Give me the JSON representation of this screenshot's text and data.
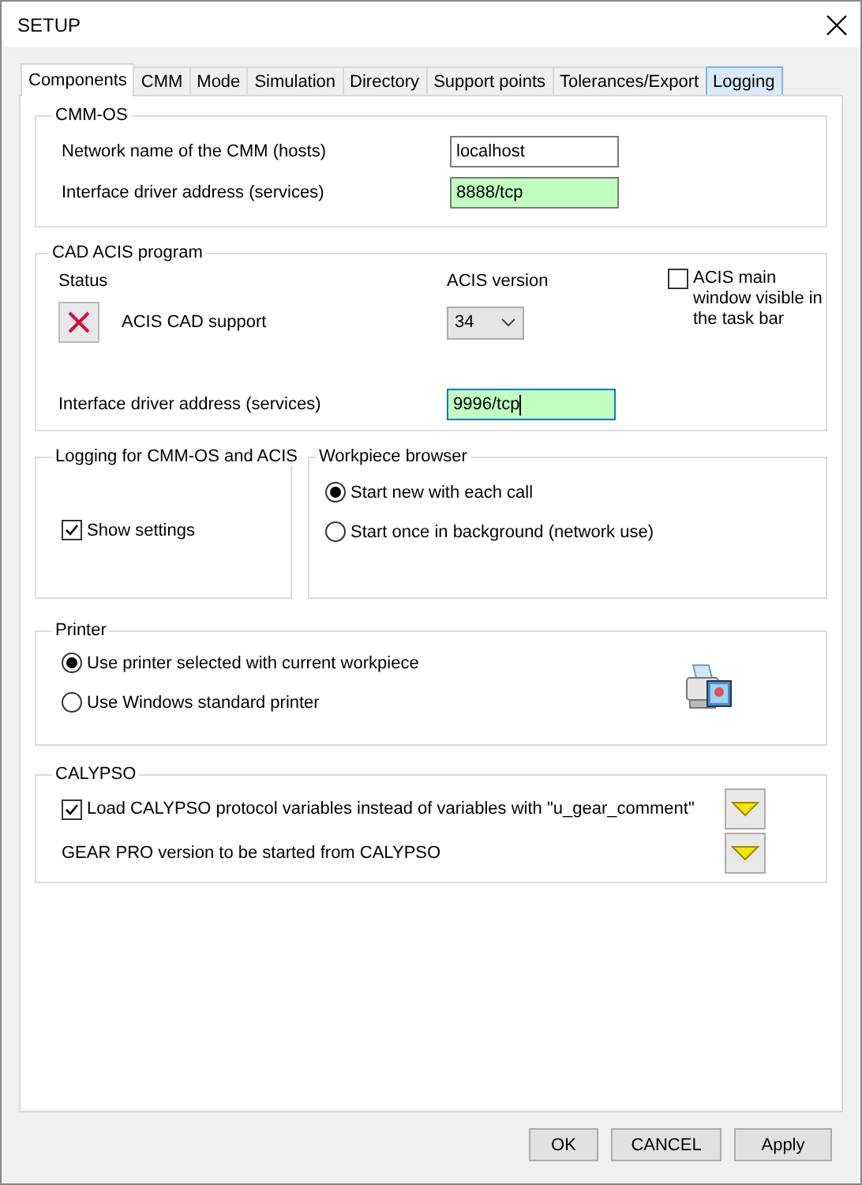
{
  "window": {
    "title": "SETUP"
  },
  "tabs": [
    {
      "label": "Components",
      "selected": true,
      "hovered": false
    },
    {
      "label": "CMM",
      "selected": false,
      "hovered": false
    },
    {
      "label": "Mode",
      "selected": false,
      "hovered": false
    },
    {
      "label": "Simulation",
      "selected": false,
      "hovered": false
    },
    {
      "label": "Directory",
      "selected": false,
      "hovered": false
    },
    {
      "label": "Support points",
      "selected": false,
      "hovered": false
    },
    {
      "label": "Tolerances/Export",
      "selected": false,
      "hovered": false
    },
    {
      "label": "Logging",
      "selected": false,
      "hovered": true
    }
  ],
  "cmm_os": {
    "title": "CMM-OS",
    "fields": [
      {
        "label": "Network name of the CMM (hosts)",
        "value": "localhost",
        "highlighted": false
      },
      {
        "label": "Interface driver address (services)",
        "value": "8888/tcp",
        "highlighted": true
      }
    ]
  },
  "cad_acis": {
    "title": "CAD ACIS program",
    "status_label": "Status",
    "version_label": "ACIS version",
    "support_label": "ACIS CAD support",
    "support_ok": false,
    "version": "34",
    "main_window": {
      "label": "ACIS main window visible in the task bar",
      "checked": false
    },
    "interface": {
      "label": "Interface driver address (services)",
      "value": "9996/tcp",
      "highlighted": true,
      "focused": true
    }
  },
  "logging": {
    "title": "Logging for CMM-OS and ACIS",
    "checkbox": {
      "label": "Show settings",
      "checked": true
    }
  },
  "workpiece_browser": {
    "title": "Workpiece browser",
    "options": [
      {
        "label": "Start new with each call",
        "selected": true
      },
      {
        "label": "Start once in background (network use)",
        "selected": false
      }
    ]
  },
  "printer": {
    "title": "Printer",
    "options": [
      {
        "label": "Use printer selected with current workpiece",
        "selected": true
      },
      {
        "label": "Use Windows standard printer",
        "selected": false
      }
    ]
  },
  "calypso": {
    "title": "CALYPSO",
    "rows": [
      {
        "kind": "checkbox",
        "label": "Load CALYPSO protocol variables instead of variables with \"u_gear_comment\"",
        "checked": true
      },
      {
        "kind": "text",
        "label": "GEAR PRO version to be started from CALYPSO"
      }
    ]
  },
  "buttons": [
    "OK",
    "CANCEL",
    "Apply"
  ]
}
